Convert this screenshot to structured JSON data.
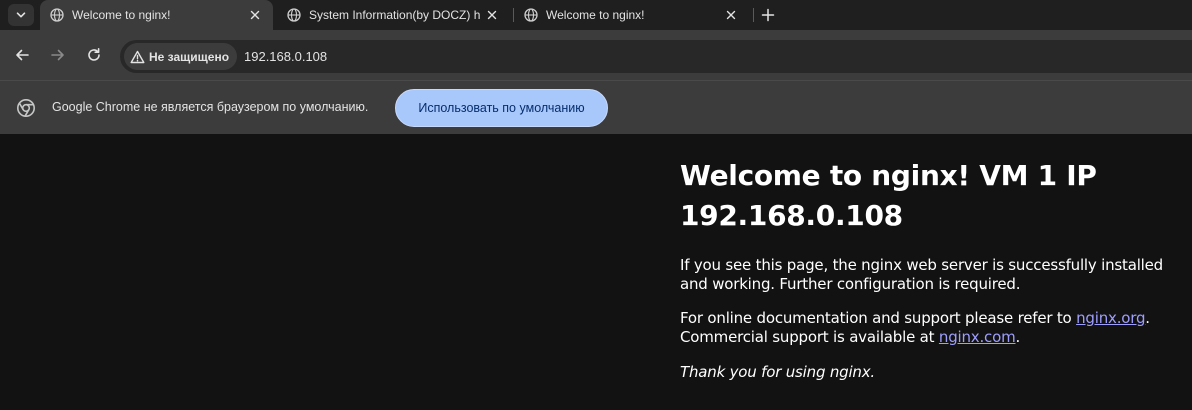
{
  "browser": {
    "tabs": [
      {
        "title": "Welcome to nginx!",
        "active": true
      },
      {
        "title": "System Information(by DOCZ) h",
        "active": false
      },
      {
        "title": "Welcome to nginx!",
        "active": false
      }
    ],
    "security_label": "Не защищено",
    "url": "192.168.0.108",
    "infobar": {
      "message": "Google Chrome не является браузером по умолчанию.",
      "button_label": "Использовать по умолчанию"
    },
    "icons": {
      "tab_search": "chevron-down-icon",
      "favicon": "globe-icon",
      "close": "close-icon",
      "new_tab": "plus-icon",
      "back": "arrow-left-icon",
      "forward": "arrow-right-icon",
      "reload": "reload-icon",
      "warning": "warning-triangle-icon",
      "chrome": "chrome-logo-icon"
    },
    "colors": {
      "accent_button": "#a8c7fa",
      "link": "#9e9eff",
      "page_background": "#121212"
    }
  },
  "page": {
    "heading": "Welcome to nginx! VM 1 IP 192.168.0.108",
    "p1": "If you see this page, the nginx web server is successfully installed and working. Further configuration is required.",
    "p2_before": "For online documentation and support please refer to ",
    "p2_link": "nginx.org",
    "p2_between": ". Commercial support is available at ",
    "p2_link2": "nginx.com",
    "p2_after": ".",
    "p3": "Thank you for using nginx."
  }
}
